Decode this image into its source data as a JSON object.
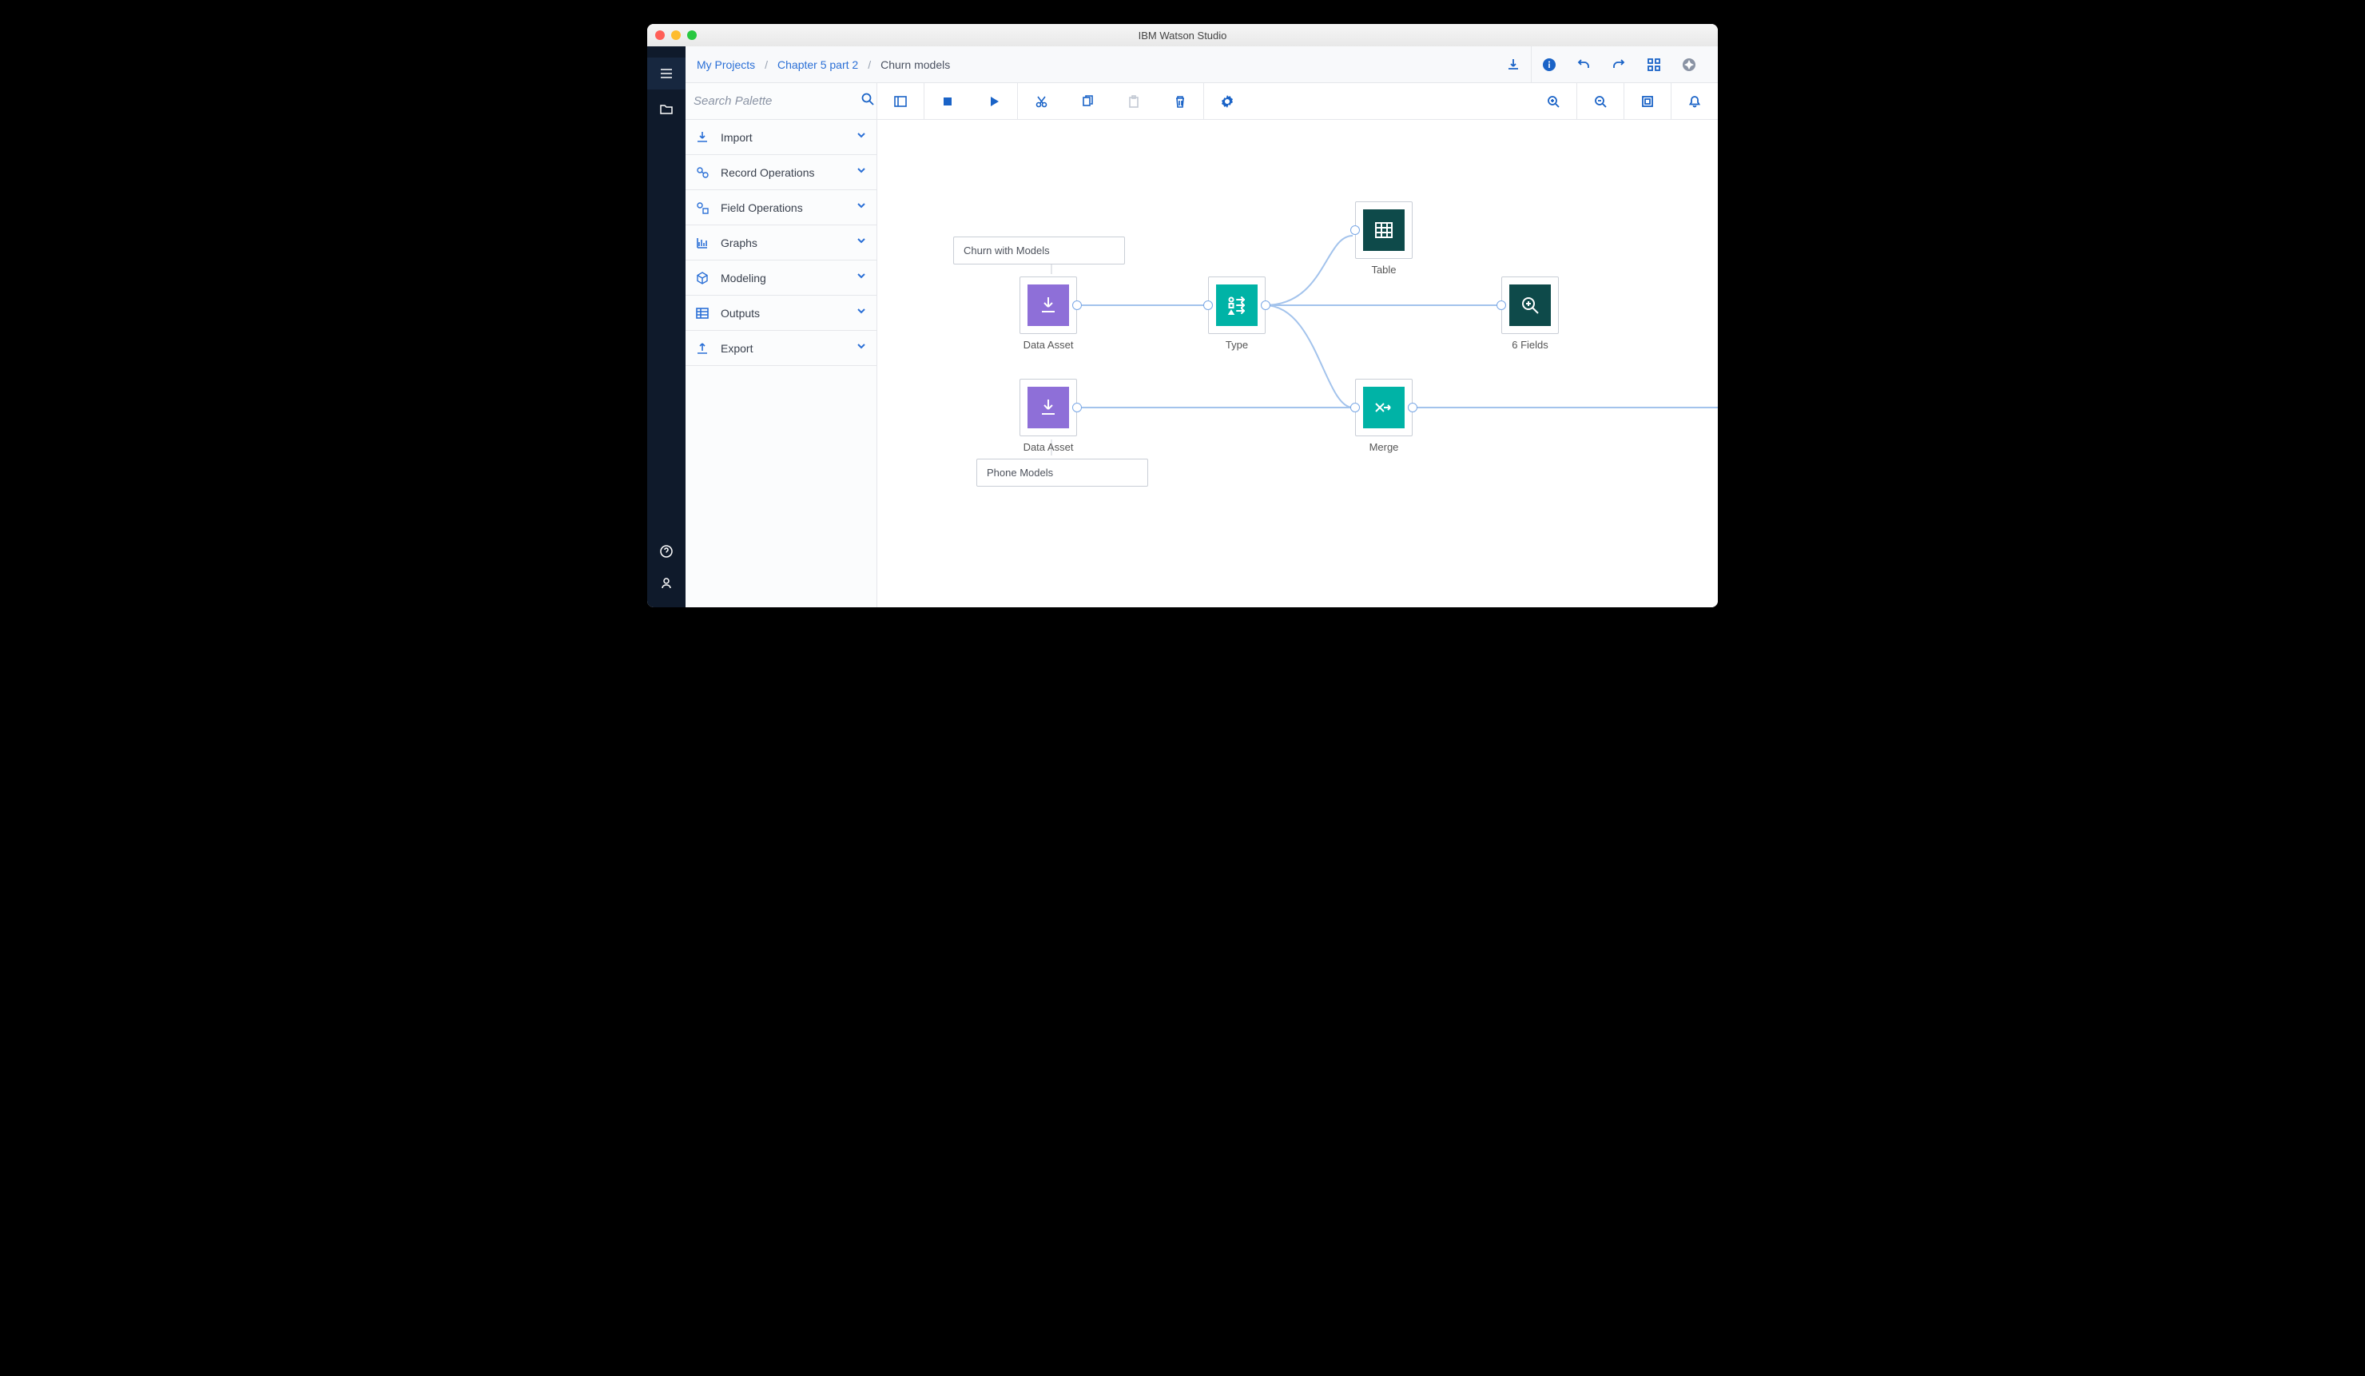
{
  "window": {
    "title": "IBM Watson Studio"
  },
  "breadcrumb": {
    "item1": "My Projects",
    "item2": "Chapter 5 part 2",
    "current": "Churn models"
  },
  "search": {
    "placeholder": "Search Palette"
  },
  "palette": {
    "items": [
      {
        "id": "import",
        "label": "Import"
      },
      {
        "id": "record-ops",
        "label": "Record Operations"
      },
      {
        "id": "field-ops",
        "label": "Field Operations"
      },
      {
        "id": "graphs",
        "label": "Graphs"
      },
      {
        "id": "modeling",
        "label": "Modeling"
      },
      {
        "id": "outputs",
        "label": "Outputs"
      },
      {
        "id": "export",
        "label": "Export"
      }
    ]
  },
  "canvas": {
    "annotations": [
      {
        "id": "a1",
        "text": "Churn with Models"
      },
      {
        "id": "a2",
        "text": "Phone Models"
      }
    ],
    "nodes": [
      {
        "id": "n1",
        "label": "Data Asset"
      },
      {
        "id": "n2",
        "label": "Data Asset"
      },
      {
        "id": "n3",
        "label": "Type"
      },
      {
        "id": "n4",
        "label": "Table"
      },
      {
        "id": "n5",
        "label": "6 Fields"
      },
      {
        "id": "n6",
        "label": "Merge"
      }
    ]
  },
  "colors": {
    "link": "#a3c3ec",
    "accent": "#1a63c7",
    "purple": "#8e6fd8",
    "teal": "#00b3a6",
    "darkteal": "#0e4a4a"
  }
}
